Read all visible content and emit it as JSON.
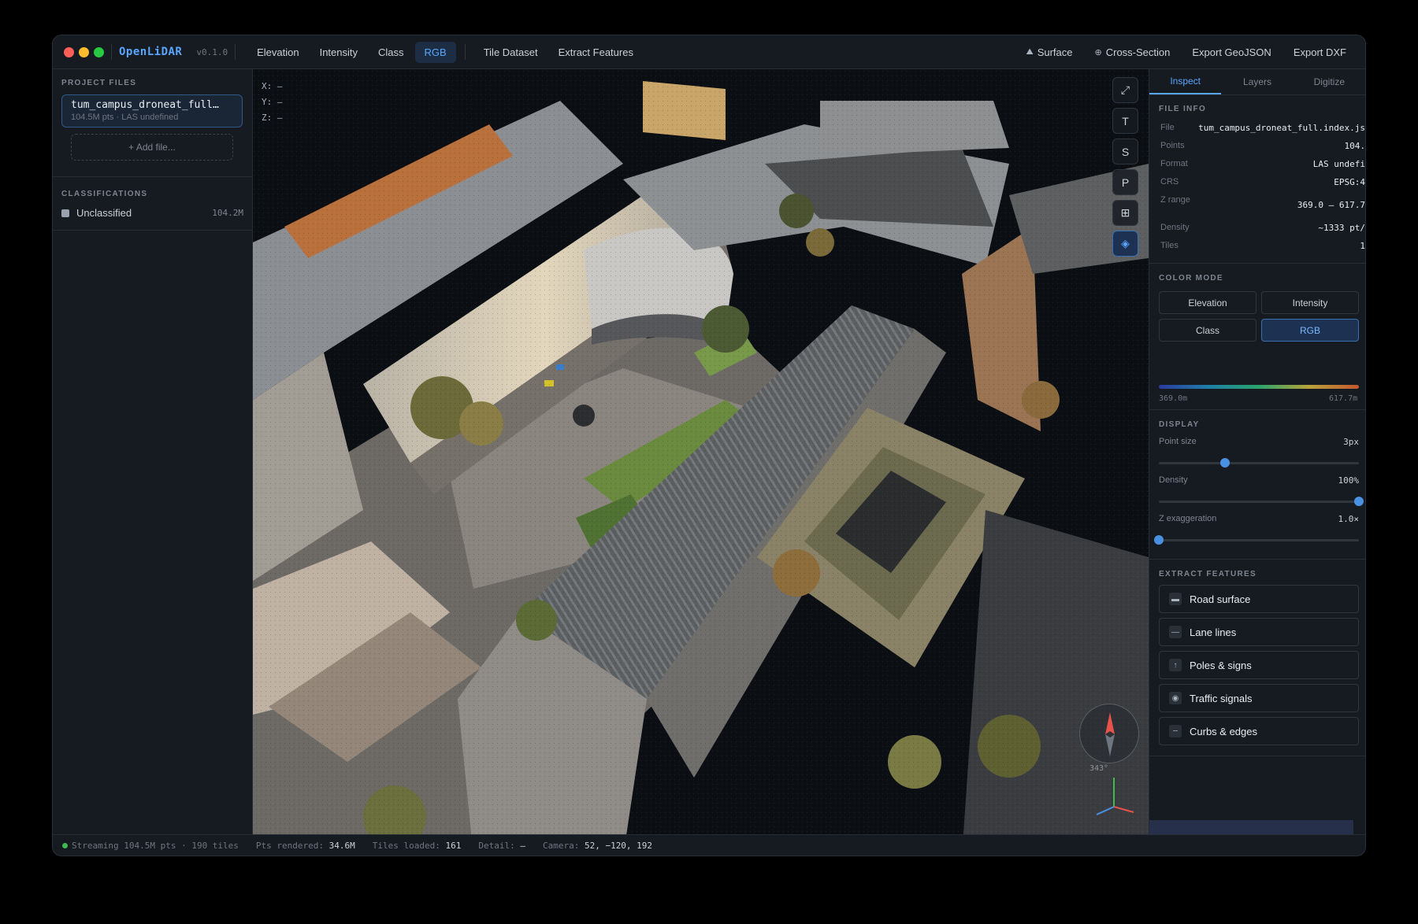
{
  "app": {
    "name": "OpenLiDAR",
    "version": "v0.1.0"
  },
  "nav": {
    "items": [
      {
        "label": "Elevation",
        "active": false
      },
      {
        "label": "Intensity",
        "active": false
      },
      {
        "label": "Class",
        "active": false
      },
      {
        "label": "RGB",
        "active": true
      },
      {
        "label": "Tile Dataset",
        "active": false
      },
      {
        "label": "Extract Features",
        "active": false
      }
    ]
  },
  "actions": {
    "surface": "Surface",
    "cross_section": "Cross-Section",
    "export_geojson": "Export GeoJSON",
    "export_dxf": "Export DXF"
  },
  "left": {
    "project_files_heading": "PROJECT FILES",
    "file": {
      "name": "tum_campus_droneat_full…",
      "meta": "104.5M pts · LAS undefined"
    },
    "add_file": "+ Add file...",
    "classifications_heading": "CLASSIFICATIONS",
    "classes": [
      {
        "name": "Unclassified",
        "count": "104.2M",
        "color": "#9aa3ad"
      }
    ]
  },
  "viewport": {
    "coords": {
      "x": "X: —",
      "y": "Y: —",
      "z": "Z: —"
    },
    "tools": [
      {
        "glyph": "⤢",
        "name": "fit-view"
      },
      {
        "glyph": "T",
        "name": "top-view"
      },
      {
        "glyph": "S",
        "name": "side-view"
      },
      {
        "glyph": "P",
        "name": "perspective-view"
      },
      {
        "glyph": "⊞",
        "name": "grid-toggle"
      },
      {
        "glyph": "◈",
        "name": "layers-toggle"
      }
    ],
    "compass_bearing": "343°"
  },
  "right": {
    "tabs": [
      {
        "label": "Inspect",
        "active": true
      },
      {
        "label": "Layers",
        "active": false
      },
      {
        "label": "Digitize",
        "active": false
      }
    ],
    "file_info_heading": "FILE INFO",
    "file_info": [
      {
        "k": "File",
        "v": "tum_campus_droneat_full.index.js"
      },
      {
        "k": "Points",
        "v": "104."
      },
      {
        "k": "Format",
        "v": "LAS undefi"
      },
      {
        "k": "CRS",
        "v": "EPSG:4"
      },
      {
        "k": "Z range",
        "v": "369.0 – 617.7"
      },
      {
        "k": "Density",
        "v": "~1333 pt/"
      },
      {
        "k": "Tiles",
        "v": "1"
      }
    ],
    "color_mode_heading": "COLOR MODE",
    "color_modes": [
      {
        "label": "Elevation",
        "active": false
      },
      {
        "label": "Intensity",
        "active": false
      },
      {
        "label": "Class",
        "active": false
      },
      {
        "label": "RGB",
        "active": true
      }
    ],
    "ramp_min": "369.0m",
    "ramp_max": "617.7m",
    "display_heading": "DISPLAY",
    "sliders": [
      {
        "label": "Point size",
        "value": "3px",
        "fraction": 0.33
      },
      {
        "label": "Density",
        "value": "100%",
        "fraction": 1.0
      },
      {
        "label": "Z exaggeration",
        "value": "1.0×",
        "fraction": 0.0
      }
    ],
    "extract_heading": "EXTRACT FEATURES",
    "features": [
      {
        "label": "Road surface",
        "icon": "▬"
      },
      {
        "label": "Lane lines",
        "icon": "—"
      },
      {
        "label": "Poles & signs",
        "icon": "↑"
      },
      {
        "label": "Traffic signals",
        "icon": "◉"
      },
      {
        "label": "Curbs & edges",
        "icon": "╌"
      }
    ]
  },
  "status": {
    "streaming": "Streaming 104.5M pts · 190 tiles",
    "pts_label": "Pts rendered:",
    "pts_value": "34.6M",
    "tiles_label": "Tiles loaded:",
    "tiles_value": "161",
    "detail_label": "Detail:",
    "detail_value": "—",
    "camera_label": "Camera:",
    "camera_value": "52, −120, 192"
  }
}
